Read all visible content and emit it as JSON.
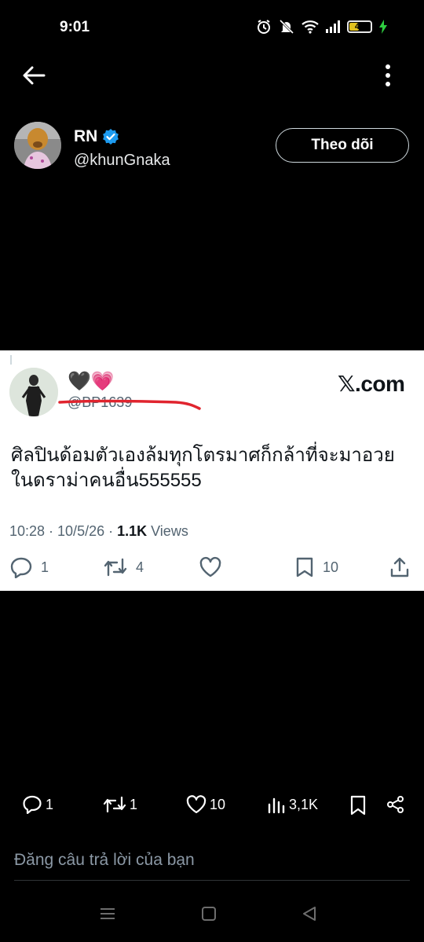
{
  "status_bar": {
    "time": "9:01",
    "battery_level": "42",
    "icons": [
      "alarm-icon",
      "mute-icon",
      "wifi-icon",
      "signal-icon",
      "battery-icon",
      "charging-icon"
    ]
  },
  "header": {
    "back_icon": "arrow-left-icon",
    "more_icon": "more-vertical-icon"
  },
  "profile": {
    "name": "RN",
    "verified": true,
    "handle": "@khunGnaka",
    "follow_label": "Theo dõi"
  },
  "quoted_tweet": {
    "display_name": "🖤💗",
    "handle": "@BP1639",
    "brand": "𝕏.com",
    "text": "ศิลปินด้อมตัวเองล้มทุกโตรมาศก็กล้าที่จะมาอวยในดราม่าคนอื่น555555",
    "timestamp": "10:28 · 10/5/26 · ",
    "views_count": "1.1K",
    "views_label": " Views",
    "replies": "1",
    "retweets": "4",
    "likes": "",
    "bookmarks": "10"
  },
  "post_actions": {
    "replies": "1",
    "reposts": "1",
    "likes": "10",
    "views": "3,1K"
  },
  "reply": {
    "placeholder": "Đăng câu trả lời của bạn"
  },
  "colors": {
    "background": "#000000",
    "card_background": "#ffffff",
    "verified_blue": "#1d9bf0",
    "redaction_red": "#e0242e",
    "muted_text": "#536471"
  }
}
